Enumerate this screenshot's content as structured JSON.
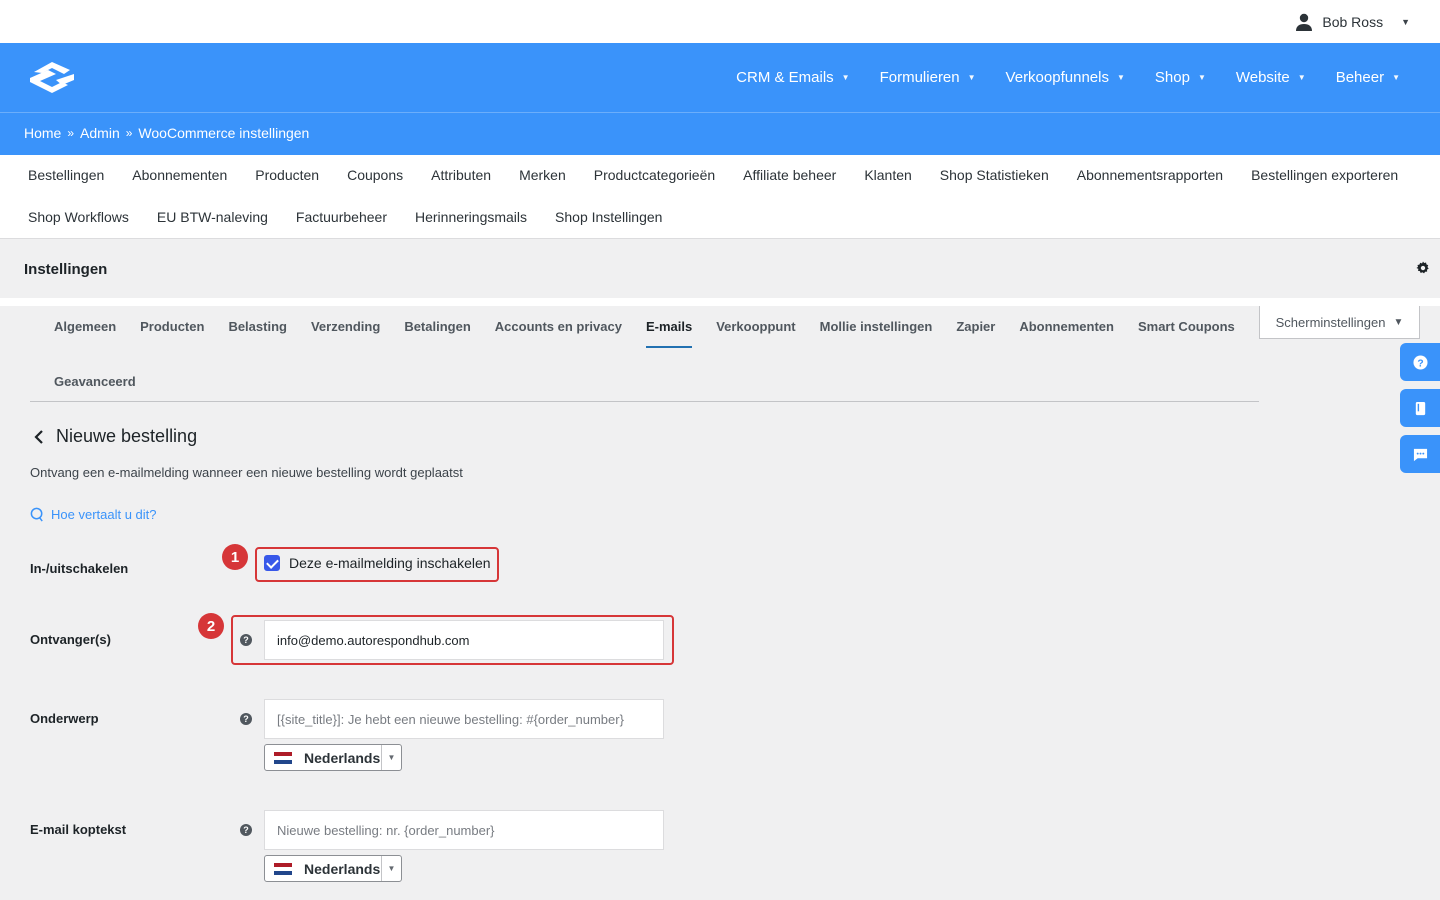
{
  "user": {
    "name": "Bob Ross"
  },
  "main_nav": [
    {
      "label": "CRM & Emails"
    },
    {
      "label": "Formulieren"
    },
    {
      "label": "Verkoopfunnels"
    },
    {
      "label": "Shop"
    },
    {
      "label": "Website"
    },
    {
      "label": "Beheer"
    }
  ],
  "breadcrumb": [
    "Home",
    "Admin",
    "WooCommerce instellingen"
  ],
  "breadcrumb_sep": "»",
  "shop_menu": {
    "row1": [
      "Bestellingen",
      "Abonnementen",
      "Producten",
      "Coupons",
      "Attributen",
      "Merken",
      "Productcategorieën",
      "Affiliate beheer",
      "Klanten",
      "Shop Statistieken",
      "Abonnementsrapporten",
      "Bestellingen exporteren"
    ],
    "row2": [
      "Shop Workflows",
      "EU BTW-naleving",
      "Factuurbeheer",
      "Herinneringsmails",
      "Shop Instellingen"
    ]
  },
  "settings_title": "Instellingen",
  "wc_tabs": {
    "row1": [
      "Algemeen",
      "Producten",
      "Belasting",
      "Verzending",
      "Betalingen",
      "Accounts en privacy",
      "E-mails",
      "Verkooppunt",
      "Mollie instellingen",
      "Zapier",
      "Abonnementen",
      "Smart Coupons"
    ],
    "row2": [
      "Geavanceerd"
    ],
    "active": "E-mails"
  },
  "screen_options": {
    "label": "Scherminstellingen"
  },
  "email": {
    "title": "Nieuwe bestelling",
    "description": "Ontvang een e-mailmelding wanneer een nieuwe bestelling wordt geplaatst",
    "translate_link": "Hoe vertaalt u dit?"
  },
  "fields": {
    "enable": {
      "label": "In-/uitschakelen",
      "checkbox_label": "Deze e-mailmelding inschakelen",
      "checked": true
    },
    "recipient": {
      "label": "Ontvanger(s)",
      "value": "info@demo.autorespondhub.com"
    },
    "subject": {
      "label": "Onderwerp",
      "placeholder": "[{site_title}]: Je hebt een nieuwe bestelling: #{order_number}",
      "language": "Nederlands"
    },
    "heading": {
      "label": "E-mail koptekst",
      "placeholder": "Nieuwe bestelling: nr. {order_number}",
      "language": "Nederlands"
    }
  },
  "help_glyph": "?",
  "annotations": {
    "one": "1",
    "two": "2"
  },
  "colors": {
    "brand": "#3a93fa",
    "highlight": "#d63638",
    "checkbox": "#3858e9",
    "tab_underline": "#2271b1"
  }
}
